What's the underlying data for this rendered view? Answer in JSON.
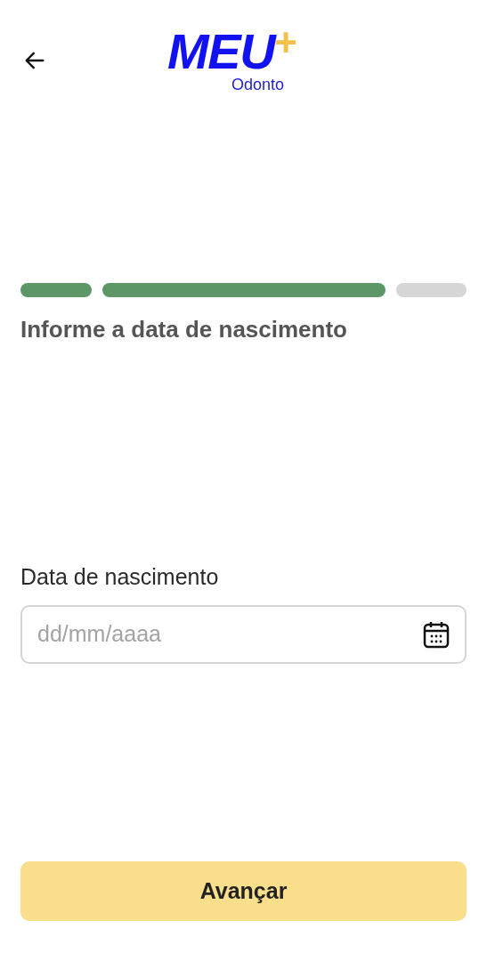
{
  "header": {
    "logo": {
      "word": "MEU",
      "plus": "+",
      "subtitle": "Odonto"
    }
  },
  "progress": [
    {
      "done": true
    },
    {
      "done": true
    },
    {
      "done": false
    }
  ],
  "heading": "Informe a data de nascimento",
  "field": {
    "label": "Data de nascimento",
    "placeholder": "dd/mm/aaaa"
  },
  "button": {
    "label": "Avançar"
  }
}
